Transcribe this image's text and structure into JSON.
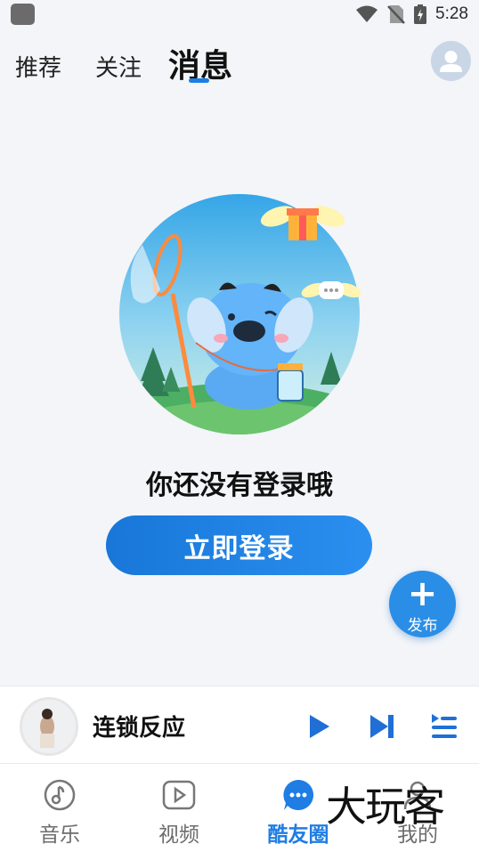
{
  "status_bar": {
    "time": "5:28"
  },
  "top_tabs": {
    "recommend": "推荐",
    "follow": "关注",
    "messages": "消息"
  },
  "empty_state": {
    "prompt": "你还没有登录哦",
    "login_button": "立即登录"
  },
  "publish_fab": {
    "plus": "+",
    "label": "发布"
  },
  "mini_player": {
    "song_title": "连锁反应"
  },
  "bottom_nav": {
    "items": [
      {
        "label": "音乐",
        "icon": "music-note-icon"
      },
      {
        "label": "视频",
        "icon": "video-play-icon"
      },
      {
        "label": "酷友圈",
        "icon": "chat-bubble-icon",
        "active": true
      },
      {
        "label": "我的",
        "icon": "person-icon"
      }
    ]
  },
  "watermark": "大玩客",
  "colors": {
    "accent": "#1f7de3",
    "background": "#f3f5f8"
  }
}
